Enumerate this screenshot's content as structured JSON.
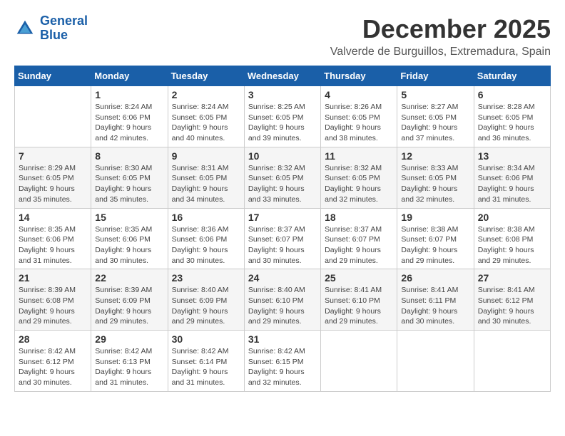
{
  "header": {
    "logo_line1": "General",
    "logo_line2": "Blue",
    "month_title": "December 2025",
    "location": "Valverde de Burguillos, Extremadura, Spain"
  },
  "weekdays": [
    "Sunday",
    "Monday",
    "Tuesday",
    "Wednesday",
    "Thursday",
    "Friday",
    "Saturday"
  ],
  "weeks": [
    [
      {
        "day": "",
        "info": ""
      },
      {
        "day": "1",
        "info": "Sunrise: 8:24 AM\nSunset: 6:06 PM\nDaylight: 9 hours\nand 42 minutes."
      },
      {
        "day": "2",
        "info": "Sunrise: 8:24 AM\nSunset: 6:05 PM\nDaylight: 9 hours\nand 40 minutes."
      },
      {
        "day": "3",
        "info": "Sunrise: 8:25 AM\nSunset: 6:05 PM\nDaylight: 9 hours\nand 39 minutes."
      },
      {
        "day": "4",
        "info": "Sunrise: 8:26 AM\nSunset: 6:05 PM\nDaylight: 9 hours\nand 38 minutes."
      },
      {
        "day": "5",
        "info": "Sunrise: 8:27 AM\nSunset: 6:05 PM\nDaylight: 9 hours\nand 37 minutes."
      },
      {
        "day": "6",
        "info": "Sunrise: 8:28 AM\nSunset: 6:05 PM\nDaylight: 9 hours\nand 36 minutes."
      }
    ],
    [
      {
        "day": "7",
        "info": "Sunrise: 8:29 AM\nSunset: 6:05 PM\nDaylight: 9 hours\nand 35 minutes."
      },
      {
        "day": "8",
        "info": "Sunrise: 8:30 AM\nSunset: 6:05 PM\nDaylight: 9 hours\nand 35 minutes."
      },
      {
        "day": "9",
        "info": "Sunrise: 8:31 AM\nSunset: 6:05 PM\nDaylight: 9 hours\nand 34 minutes."
      },
      {
        "day": "10",
        "info": "Sunrise: 8:32 AM\nSunset: 6:05 PM\nDaylight: 9 hours\nand 33 minutes."
      },
      {
        "day": "11",
        "info": "Sunrise: 8:32 AM\nSunset: 6:05 PM\nDaylight: 9 hours\nand 32 minutes."
      },
      {
        "day": "12",
        "info": "Sunrise: 8:33 AM\nSunset: 6:05 PM\nDaylight: 9 hours\nand 32 minutes."
      },
      {
        "day": "13",
        "info": "Sunrise: 8:34 AM\nSunset: 6:06 PM\nDaylight: 9 hours\nand 31 minutes."
      }
    ],
    [
      {
        "day": "14",
        "info": "Sunrise: 8:35 AM\nSunset: 6:06 PM\nDaylight: 9 hours\nand 31 minutes."
      },
      {
        "day": "15",
        "info": "Sunrise: 8:35 AM\nSunset: 6:06 PM\nDaylight: 9 hours\nand 30 minutes."
      },
      {
        "day": "16",
        "info": "Sunrise: 8:36 AM\nSunset: 6:06 PM\nDaylight: 9 hours\nand 30 minutes."
      },
      {
        "day": "17",
        "info": "Sunrise: 8:37 AM\nSunset: 6:07 PM\nDaylight: 9 hours\nand 30 minutes."
      },
      {
        "day": "18",
        "info": "Sunrise: 8:37 AM\nSunset: 6:07 PM\nDaylight: 9 hours\nand 29 minutes."
      },
      {
        "day": "19",
        "info": "Sunrise: 8:38 AM\nSunset: 6:07 PM\nDaylight: 9 hours\nand 29 minutes."
      },
      {
        "day": "20",
        "info": "Sunrise: 8:38 AM\nSunset: 6:08 PM\nDaylight: 9 hours\nand 29 minutes."
      }
    ],
    [
      {
        "day": "21",
        "info": "Sunrise: 8:39 AM\nSunset: 6:08 PM\nDaylight: 9 hours\nand 29 minutes."
      },
      {
        "day": "22",
        "info": "Sunrise: 8:39 AM\nSunset: 6:09 PM\nDaylight: 9 hours\nand 29 minutes."
      },
      {
        "day": "23",
        "info": "Sunrise: 8:40 AM\nSunset: 6:09 PM\nDaylight: 9 hours\nand 29 minutes."
      },
      {
        "day": "24",
        "info": "Sunrise: 8:40 AM\nSunset: 6:10 PM\nDaylight: 9 hours\nand 29 minutes."
      },
      {
        "day": "25",
        "info": "Sunrise: 8:41 AM\nSunset: 6:10 PM\nDaylight: 9 hours\nand 29 minutes."
      },
      {
        "day": "26",
        "info": "Sunrise: 8:41 AM\nSunset: 6:11 PM\nDaylight: 9 hours\nand 30 minutes."
      },
      {
        "day": "27",
        "info": "Sunrise: 8:41 AM\nSunset: 6:12 PM\nDaylight: 9 hours\nand 30 minutes."
      }
    ],
    [
      {
        "day": "28",
        "info": "Sunrise: 8:42 AM\nSunset: 6:12 PM\nDaylight: 9 hours\nand 30 minutes."
      },
      {
        "day": "29",
        "info": "Sunrise: 8:42 AM\nSunset: 6:13 PM\nDaylight: 9 hours\nand 31 minutes."
      },
      {
        "day": "30",
        "info": "Sunrise: 8:42 AM\nSunset: 6:14 PM\nDaylight: 9 hours\nand 31 minutes."
      },
      {
        "day": "31",
        "info": "Sunrise: 8:42 AM\nSunset: 6:15 PM\nDaylight: 9 hours\nand 32 minutes."
      },
      {
        "day": "",
        "info": ""
      },
      {
        "day": "",
        "info": ""
      },
      {
        "day": "",
        "info": ""
      }
    ]
  ]
}
